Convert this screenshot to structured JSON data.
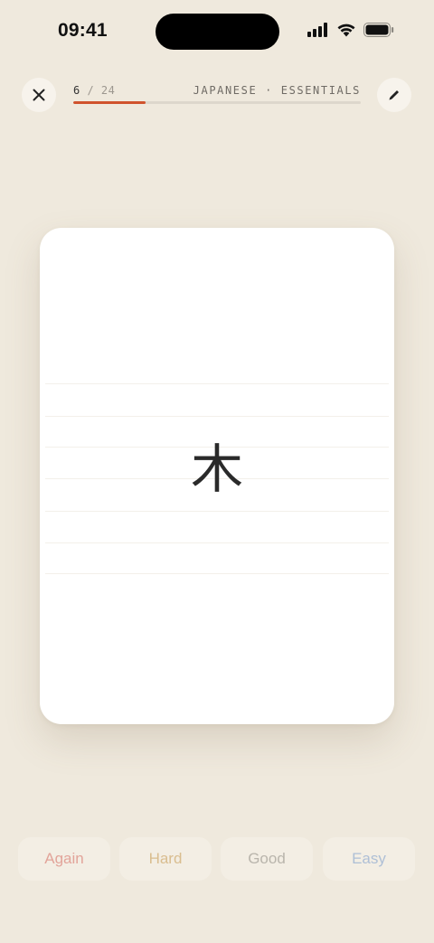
{
  "status": {
    "time": "09:41"
  },
  "header": {
    "current": "6",
    "separator": " / ",
    "total": "24",
    "progress_fraction": 0.25,
    "deck_title": "JAPANESE · ESSENTIALS"
  },
  "card": {
    "term": "木"
  },
  "ratings": [
    {
      "label": "Again",
      "color": "#e2a49a"
    },
    {
      "label": "Hard",
      "color": "#d9bd8f"
    },
    {
      "label": "Good",
      "color": "#b9b5ac"
    },
    {
      "label": "Easy",
      "color": "#aebfd6"
    }
  ],
  "colors": {
    "accent": "#d0532d",
    "background": "#efe9dd"
  },
  "icons": [
    "close-icon",
    "pencil-icon",
    "signal-icon",
    "wifi-icon",
    "battery-icon"
  ]
}
